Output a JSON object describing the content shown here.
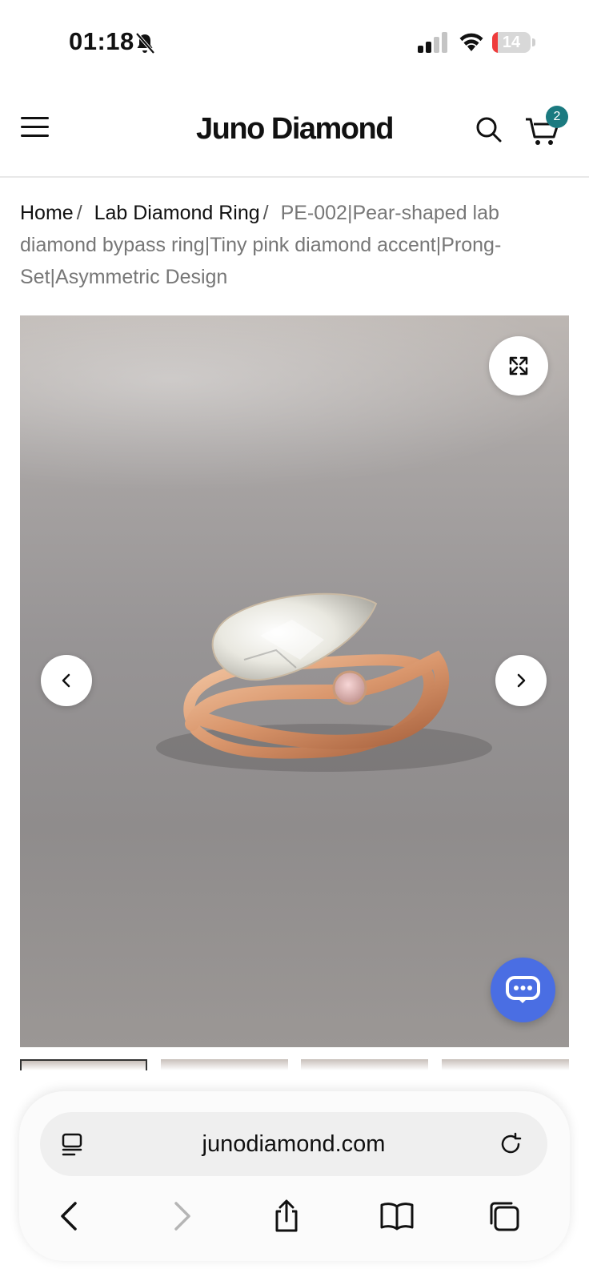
{
  "status_bar": {
    "time": "01:18",
    "battery_level": "14",
    "battery_fraction": 0.14,
    "icons": [
      "bell-slash-icon",
      "cellular-signal-icon",
      "wifi-icon",
      "battery-icon"
    ]
  },
  "header": {
    "logo": "Juno Diamond",
    "cart_count": "2",
    "icons": [
      "menu-icon",
      "search-icon",
      "cart-icon"
    ]
  },
  "breadcrumb": {
    "home": "Home",
    "separator": "/",
    "category": "Lab Diamond Ring",
    "current": "PE-002|Pear-shaped lab diamond bypass ring|Tiny pink diamond accent|Prong-Set|Asymmetric Design"
  },
  "gallery": {
    "controls": [
      "expand-icon",
      "chevron-left-icon",
      "chevron-right-icon",
      "chat-icon"
    ],
    "thumbnail_count": 4,
    "active_thumbnail": 1
  },
  "browser": {
    "url": "junodiamond.com",
    "icons": [
      "page-menu-icon",
      "reload-icon",
      "back-icon",
      "forward-icon",
      "share-icon",
      "bookmarks-icon",
      "tabs-icon"
    ]
  },
  "colors": {
    "badge": "#1b7a80",
    "chat_button": "#4a6ee3",
    "battery_low": "#ef3b3b"
  }
}
